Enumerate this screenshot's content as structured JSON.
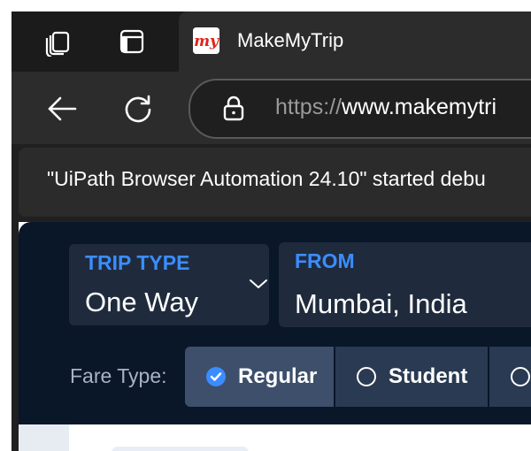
{
  "tab": {
    "title": "MakeMyTrip",
    "favicon_text": "my"
  },
  "address": {
    "scheme": "https://",
    "host": "www.makemytri"
  },
  "infobar": {
    "message": "\"UiPath Browser Automation 24.10\" started debu"
  },
  "search": {
    "trip_type": {
      "label": "TRIP TYPE",
      "value": "One Way"
    },
    "from": {
      "label": "FROM",
      "value": "Mumbai, India"
    },
    "fare_type_label": "Fare Type:",
    "fare_options": [
      {
        "label": "Regular",
        "selected": true
      },
      {
        "label": "Student",
        "selected": false
      }
    ]
  },
  "colors": {
    "accent": "#3b8dff",
    "hero_bg": "#0a1729",
    "field_bg": "#1f2b3d",
    "brand_red": "#e2231a"
  },
  "icons": [
    "workspaces-icon",
    "tab-actions-icon",
    "back-arrow-icon",
    "refresh-icon",
    "lock-icon",
    "chevron-down-icon",
    "radio-checked-icon",
    "radio-unchecked-icon"
  ]
}
